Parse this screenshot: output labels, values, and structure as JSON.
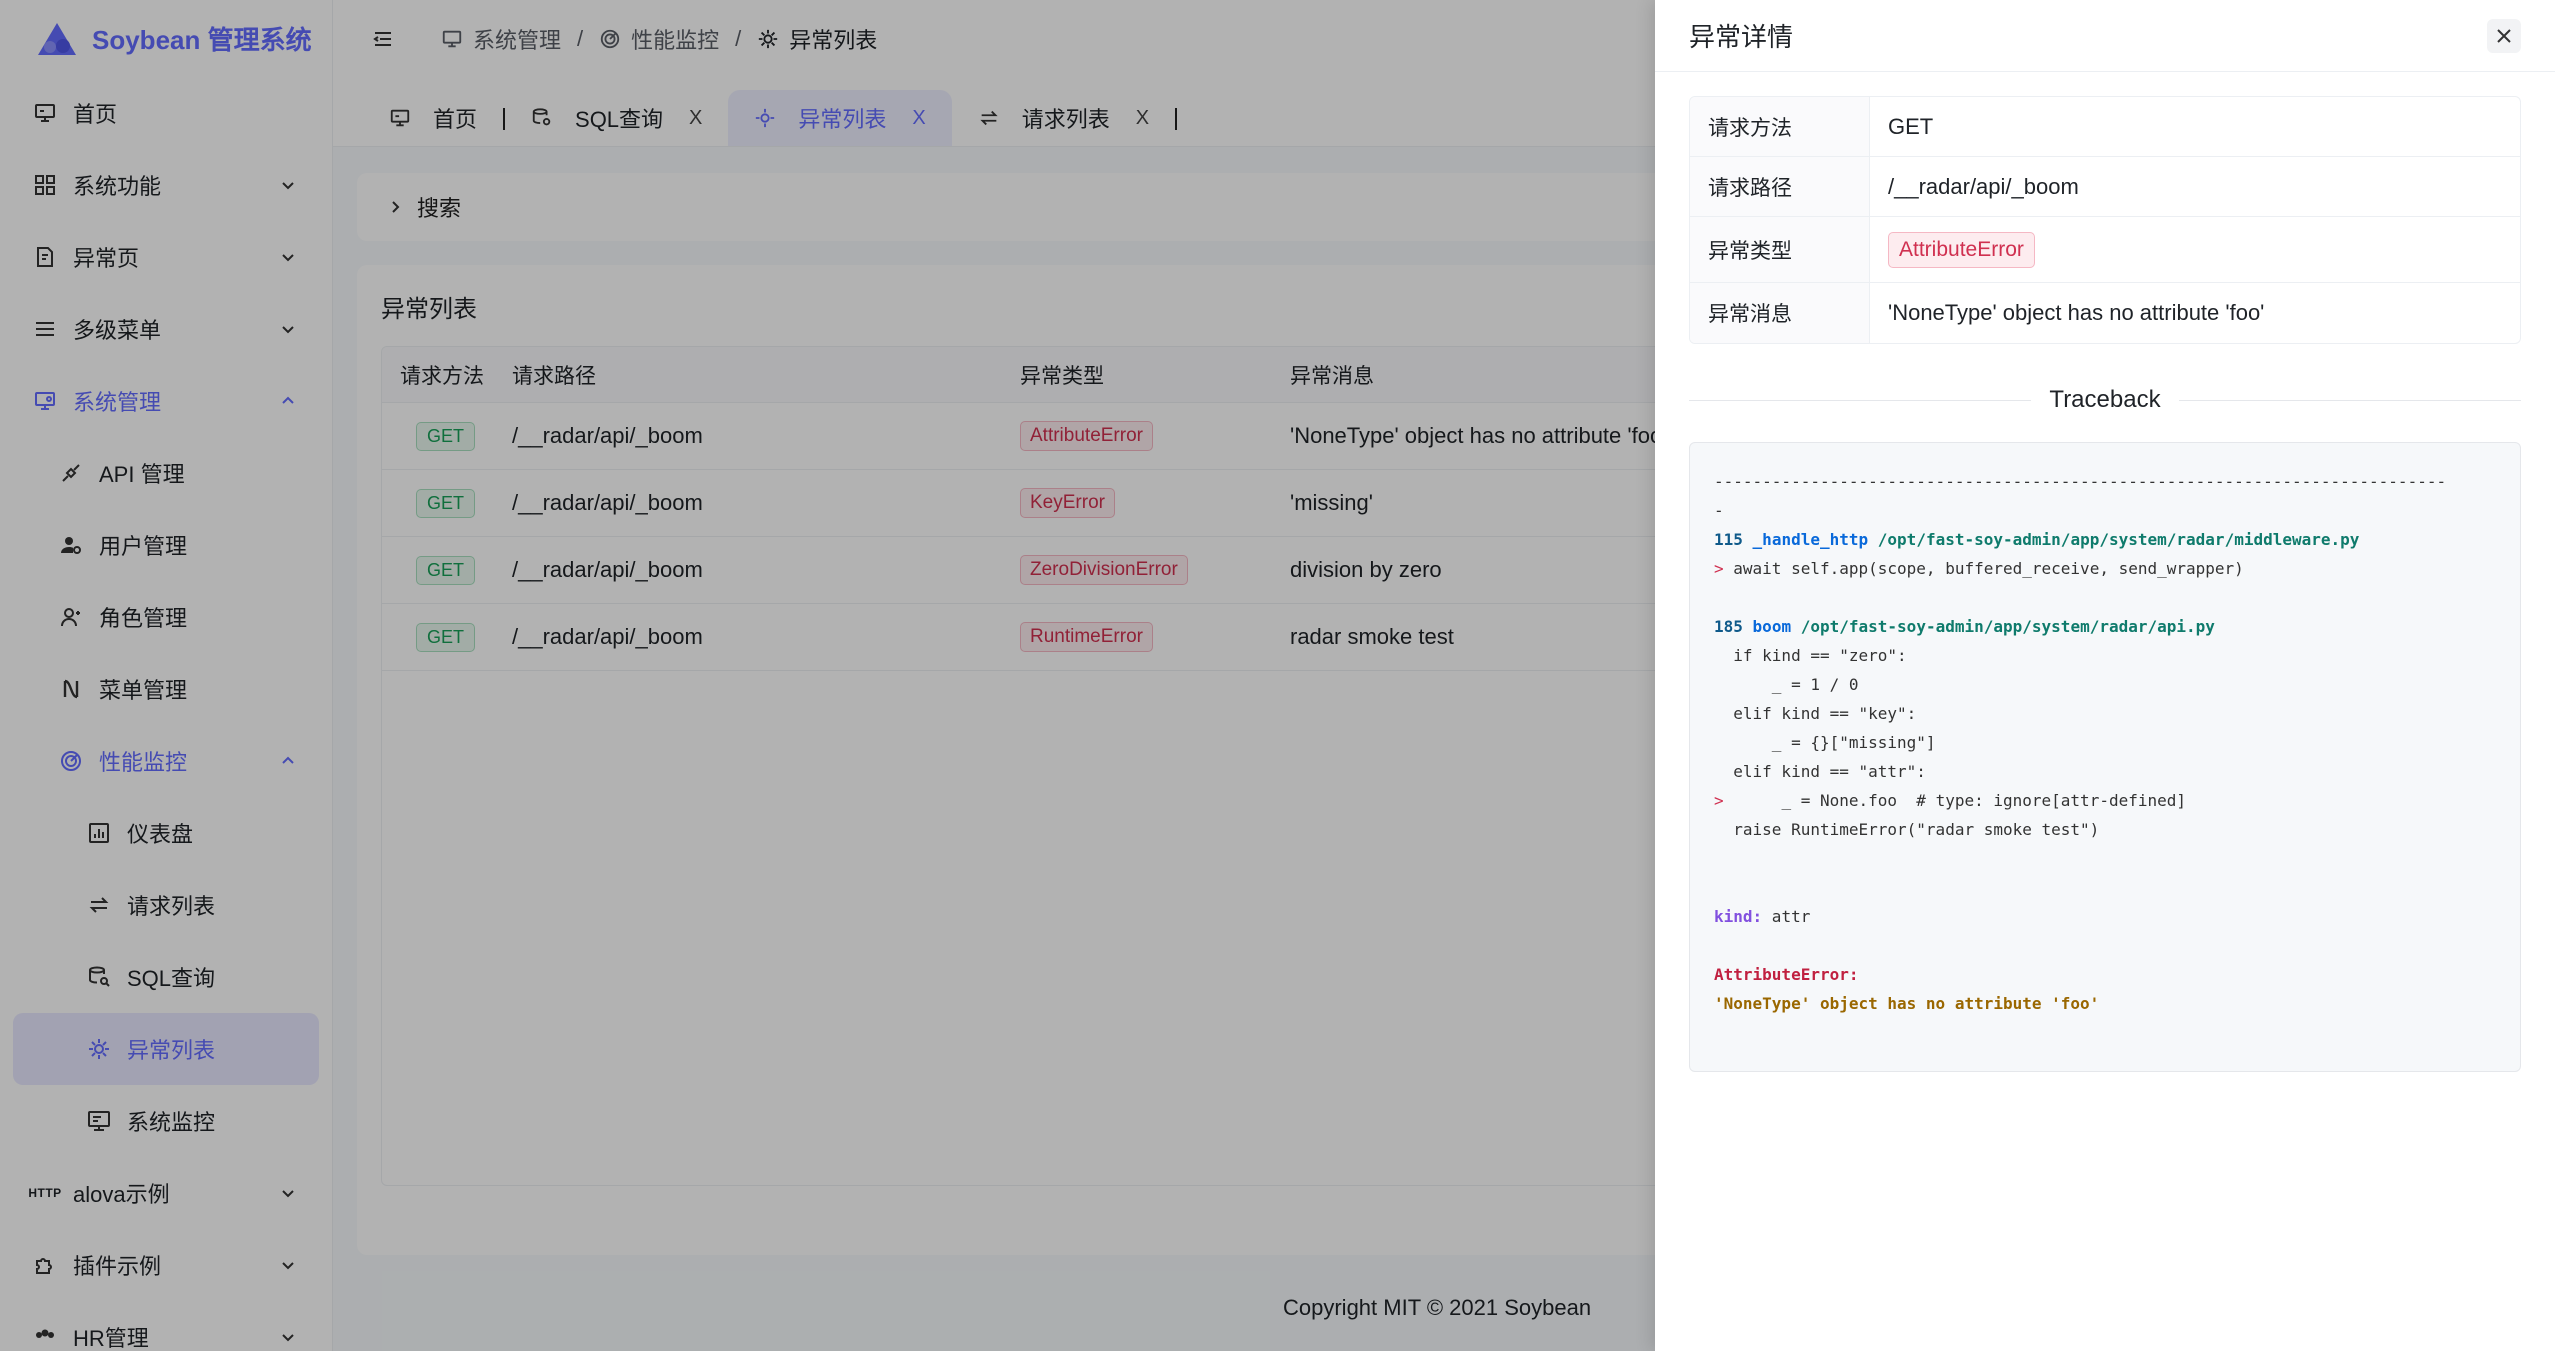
{
  "app": {
    "title": "Soybean 管理系统"
  },
  "sidebar": {
    "items": [
      {
        "label": "首页",
        "icon": "monitor-icon"
      },
      {
        "label": "系统功能",
        "icon": "grid-icon"
      },
      {
        "label": "异常页",
        "icon": "exception-icon"
      },
      {
        "label": "多级菜单",
        "icon": "menu-lines-icon"
      },
      {
        "label": "系统管理",
        "icon": "system-manage-icon"
      },
      {
        "label": "API 管理",
        "icon": "api-icon"
      },
      {
        "label": "用户管理",
        "icon": "user-gear-icon"
      },
      {
        "label": "角色管理",
        "icon": "role-icon"
      },
      {
        "label": "菜单管理",
        "icon": "menu-manage-icon"
      },
      {
        "label": "性能监控",
        "icon": "radar-icon"
      },
      {
        "label": "仪表盘",
        "icon": "dashboard-icon"
      },
      {
        "label": "请求列表",
        "icon": "swap-icon"
      },
      {
        "label": "SQL查询",
        "icon": "database-search-icon"
      },
      {
        "label": "异常列表",
        "icon": "bug-gear-icon"
      },
      {
        "label": "系统监控",
        "icon": "system-monitor-icon"
      },
      {
        "label": "alova示例",
        "icon": "http-icon",
        "icon_text": "HTTP"
      },
      {
        "label": "插件示例",
        "icon": "plugin-icon"
      },
      {
        "label": "HR管理",
        "icon": "team-icon"
      }
    ]
  },
  "header": {
    "breadcrumb": [
      {
        "label": "系统管理"
      },
      {
        "label": "性能监控"
      },
      {
        "label": "异常列表"
      }
    ],
    "separator": "/"
  },
  "tabs": [
    {
      "label": "首页"
    },
    {
      "label": "SQL查询",
      "close": "X"
    },
    {
      "label": "异常列表",
      "close": "X"
    },
    {
      "label": "请求列表",
      "close": "X"
    }
  ],
  "search": {
    "label": "搜索"
  },
  "list": {
    "title": "异常列表",
    "columns": [
      "请求方法",
      "请求路径",
      "异常类型",
      "异常消息"
    ],
    "rows": [
      {
        "method": "GET",
        "path": "/__radar/api/_boom",
        "type": "AttributeError",
        "message": "'NoneType' object has no attribute 'foo'"
      },
      {
        "method": "GET",
        "path": "/__radar/api/_boom",
        "type": "KeyError",
        "message": "'missing'"
      },
      {
        "method": "GET",
        "path": "/__radar/api/_boom",
        "type": "ZeroDivisionError",
        "message": "division by zero"
      },
      {
        "method": "GET",
        "path": "/__radar/api/_boom",
        "type": "RuntimeError",
        "message": "radar smoke test"
      }
    ]
  },
  "footer": {
    "text": "Copyright MIT © 2021 Soybean"
  },
  "drawer": {
    "title": "异常详情",
    "fields": [
      {
        "label": "请求方法",
        "value": "GET"
      },
      {
        "label": "请求路径",
        "value": "/__radar/api/_boom"
      },
      {
        "label": "异常类型",
        "value": "AttributeError"
      },
      {
        "label": "异常消息",
        "value": "'NoneType' object has no attribute 'foo'"
      }
    ],
    "traceback_title": "Traceback",
    "traceback": {
      "rule": "----------------------------------------------------------------------------",
      "rule_tail": "-",
      "frame1": {
        "line": "115",
        "func": "_handle_http",
        "path": "/opt/fast-soy-admin/app/system/radar/middleware.py",
        "marker": ">",
        "code": " await self.app(scope, buffered_receive, send_wrapper)"
      },
      "frame2": {
        "line": "185",
        "func": "boom",
        "path": "/opt/fast-soy-admin/app/system/radar/api.py",
        "code1": "  if kind == \"zero\":",
        "code2": "      _ = 1 / 0",
        "code3": "  elif kind == \"key\":",
        "code4": "      _ = {}[\"missing\"]",
        "code5": "  elif kind == \"attr\":",
        "marker": ">",
        "code6": "      _ = None.foo  # type: ignore[attr-defined]",
        "code7": "  raise RuntimeError(\"radar smoke test\")"
      },
      "kind_label": "kind:",
      "kind_value": " attr",
      "error_type": "AttributeError:",
      "error_message": "'NoneType' object has no attribute 'foo'"
    }
  },
  "colors": {
    "primary": "#646cff",
    "success": "#18a058",
    "error": "#d03050"
  }
}
